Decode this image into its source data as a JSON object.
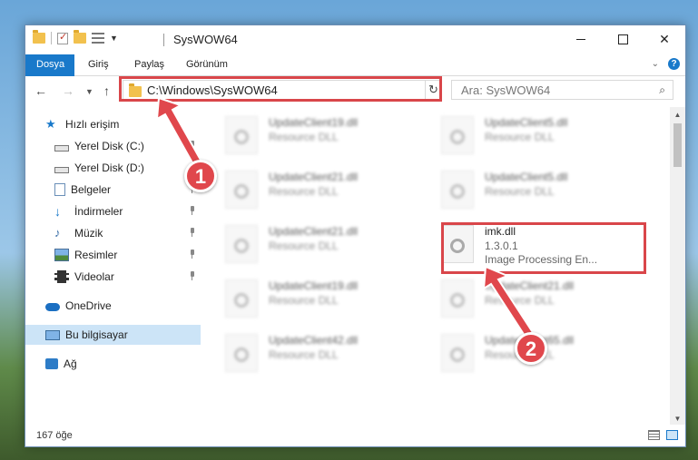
{
  "window": {
    "title": "SysWOW64"
  },
  "ribbon": {
    "tabs": [
      "Dosya",
      "Giriş",
      "Paylaş",
      "Görünüm"
    ],
    "help_icon": "?"
  },
  "address_bar": {
    "path": "C:\\Windows\\SysWOW64",
    "search_placeholder": "Ara: SysWOW64"
  },
  "nav_pane": {
    "items": [
      {
        "label": "Hızlı erişim",
        "icon": "star-icon"
      },
      {
        "label": "Yerel Disk (C:)",
        "icon": "drive-icon",
        "pinned": true
      },
      {
        "label": "Yerel Disk (D:)",
        "icon": "drive-icon",
        "pinned": true
      },
      {
        "label": "Belgeler",
        "icon": "document-icon",
        "pinned": true
      },
      {
        "label": "İndirmeler",
        "icon": "download-icon",
        "pinned": true
      },
      {
        "label": "Müzik",
        "icon": "music-icon",
        "pinned": true
      },
      {
        "label": "Resimler",
        "icon": "pictures-icon",
        "pinned": true
      },
      {
        "label": "Videolar",
        "icon": "video-icon",
        "pinned": true
      },
      {
        "label": "OneDrive",
        "icon": "cloud-icon"
      },
      {
        "label": "Bu bilgisayar",
        "icon": "computer-icon",
        "selected": true
      },
      {
        "label": "Ağ",
        "icon": "network-icon"
      }
    ]
  },
  "files": [
    {
      "name": "UpdateClient19.dll",
      "sub": "Resource DLL"
    },
    {
      "name": "UpdateClient5.dll",
      "sub": "Resource DLL"
    },
    {
      "name": "UpdateClient21.dll",
      "sub": "Resource DLL"
    },
    {
      "name": "UpdateClient5.dll",
      "sub": "Resource DLL"
    },
    {
      "name": "UpdateClient21.dll",
      "sub": "Resource DLL"
    },
    {
      "name": "imk.dll",
      "sub": "1.3.0.1",
      "sub2": "Image Processing En..."
    },
    {
      "name": "UpdateClient19.dll",
      "sub": "Resource DLL"
    },
    {
      "name": "UpdateClient21.dll",
      "sub": "Resource DLL"
    },
    {
      "name": "UpdateClient42.dll",
      "sub": "Resource DLL"
    },
    {
      "name": "UpdateClient65.dll",
      "sub": "Resource DLL"
    }
  ],
  "status_bar": {
    "count": "167 öğe"
  },
  "callouts": [
    "1",
    "2"
  ],
  "colors": {
    "accent": "#1979ca",
    "highlight": "#d9464a",
    "selected": "#cce4f7"
  }
}
